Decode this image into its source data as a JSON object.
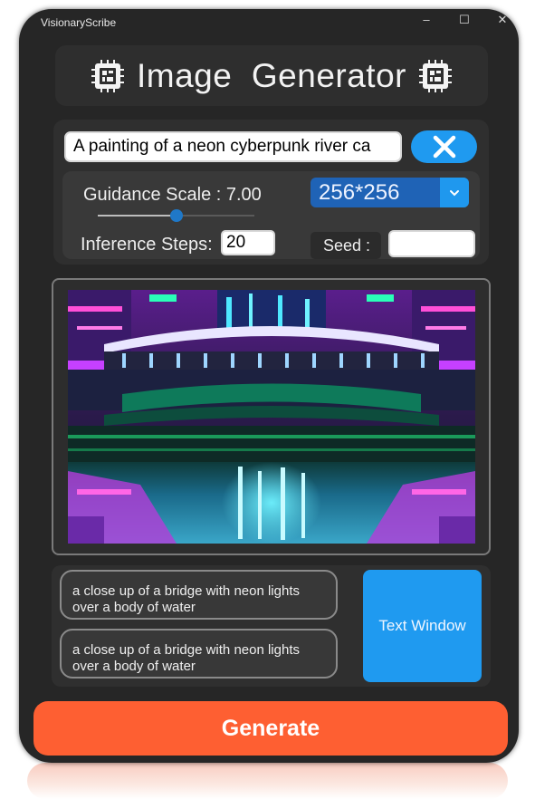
{
  "window": {
    "title": "VisionaryScribe",
    "controls": [
      "–",
      "☐",
      "✕"
    ]
  },
  "header": {
    "title": "Image  Generator",
    "icon": "cpu-icon"
  },
  "prompt": {
    "value": "A painting of a neon cyberpunk river ca",
    "clear_icon": "close-icon"
  },
  "guidance": {
    "label": "Guidance Scale : 7.00",
    "value": 7.0,
    "fraction": 0.5
  },
  "resolution": {
    "selected": "256*256",
    "icon": "chevron-down-icon"
  },
  "steps": {
    "label": "Inference Steps:",
    "value": "20"
  },
  "seed": {
    "label": "Seed :",
    "value": ""
  },
  "captions": [
    "a close up of a bridge with neon lights over a body of water",
    "a close up of a bridge with neon lights over a body of water"
  ],
  "text_window_label": "Text Window",
  "generate_label": "Generate",
  "colors": {
    "window_bg": "#262626",
    "accent_blue": "#1f9af0",
    "select_blue": "#1f63b6",
    "generate_orange": "#fe5f32"
  }
}
